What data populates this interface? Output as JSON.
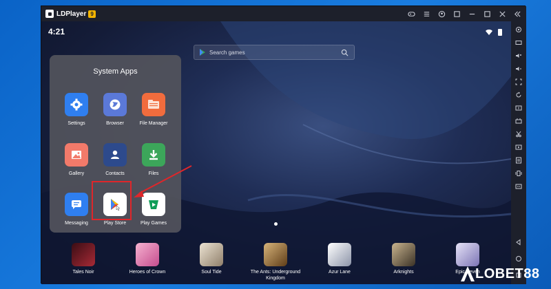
{
  "window": {
    "app_name": "LDPlayer",
    "version_badge": "9"
  },
  "status": {
    "time": "4:21"
  },
  "search": {
    "placeholder": "Search games"
  },
  "folder": {
    "title": "System Apps",
    "apps": [
      {
        "label": "Settings",
        "icon": "gear-icon",
        "color": "#2f7ff0"
      },
      {
        "label": "Browser",
        "icon": "globe-icon",
        "color": "#5b79d8"
      },
      {
        "label": "File Manager",
        "icon": "folder-icon",
        "color": "#f16c3d"
      },
      {
        "label": "Gallery",
        "icon": "image-icon",
        "color": "#f27a6a"
      },
      {
        "label": "Contacts",
        "icon": "person-icon",
        "color": "#2d4a8c"
      },
      {
        "label": "Files",
        "icon": "download-icon",
        "color": "#3ca65a"
      },
      {
        "label": "Messaging",
        "icon": "message-icon",
        "color": "#2f7ff0"
      },
      {
        "label": "Play Store",
        "icon": "play-store-icon",
        "color": "#ffffff"
      },
      {
        "label": "Play Games",
        "icon": "play-games-icon",
        "color": "#ffffff"
      }
    ]
  },
  "dock": {
    "games": [
      {
        "label": "Tales Noir",
        "icon": "tales-noir-icon",
        "color": "#8a1f2a"
      },
      {
        "label": "Heroes of Crown",
        "icon": "heroes-of-crown-icon",
        "color": "#e07ab0"
      },
      {
        "label": "Soul Tide",
        "icon": "soul-tide-icon",
        "color": "#c9b9a0"
      },
      {
        "label": "The Ants: Underground Kingdom",
        "icon": "ants-icon",
        "color": "#a8783f"
      },
      {
        "label": "Azur Lane",
        "icon": "azur-lane-icon",
        "color": "#d9dde6"
      },
      {
        "label": "Arknights",
        "icon": "arknights-icon",
        "color": "#6b5d48"
      },
      {
        "label": "Epic Seven",
        "icon": "epic-seven-icon",
        "color": "#b7b4d6"
      }
    ]
  },
  "watermark": {
    "text": "LOBET88"
  }
}
